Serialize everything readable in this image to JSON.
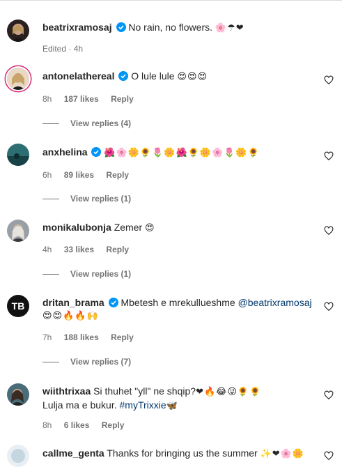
{
  "comments": [
    {
      "user": "beatrixramosaj",
      "verified": true,
      "text": "No rain, no flowers.",
      "emoji": "🌸☂❤",
      "time": "Edited · 4h"
    },
    {
      "user": "antonelathereal",
      "verified": true,
      "text": "O lule lule",
      "emoji": "😍😍😍",
      "time": "8h",
      "likes": "187 likes",
      "reply": "Reply",
      "view_replies": "View replies (4)"
    },
    {
      "user": "anxhelina",
      "verified": true,
      "text": "",
      "emoji": "🌺🌸🌼🌻🌷🌼🌺🌻🌼🌸🌷🌼🌻",
      "time": "6h",
      "likes": "89 likes",
      "reply": "Reply",
      "view_replies": "View replies (1)"
    },
    {
      "user": "monikalubonja",
      "verified": false,
      "text": "Zemer",
      "emoji": "😍",
      "time": "4h",
      "likes": "33 likes",
      "reply": "Reply",
      "view_replies": "View replies (1)"
    },
    {
      "user": "dritan_brama",
      "verified": true,
      "text": "Mbetesh e mrekullueshme",
      "mention": "@beatrixramosaj",
      "emoji": "😍😍🔥🔥🙌",
      "time": "7h",
      "likes": "188 likes",
      "reply": "Reply",
      "view_replies": "View replies (7)"
    },
    {
      "user": "wiithtrixaa",
      "verified": false,
      "text": "Si thuhet \"yll\" ne shqip?",
      "emoji": "❤🔥😂😜🌻🌻",
      "text2": "Lulja ma e bukur.",
      "hashtag": "#myTrixxie",
      "emoji2": "🦋",
      "time": "8h",
      "likes": "6 likes",
      "reply": "Reply"
    },
    {
      "user": "callme_genta",
      "verified": false,
      "text": "Thanks for bringing us the summer",
      "emoji": "✨❤🌸🌼"
    }
  ],
  "icons": {
    "verified": "verified-badge-icon",
    "like": "heart-outline-icon"
  },
  "colors": {
    "verified": "#0095f6",
    "secondary_text": "#737373",
    "mention": "#00376b"
  }
}
